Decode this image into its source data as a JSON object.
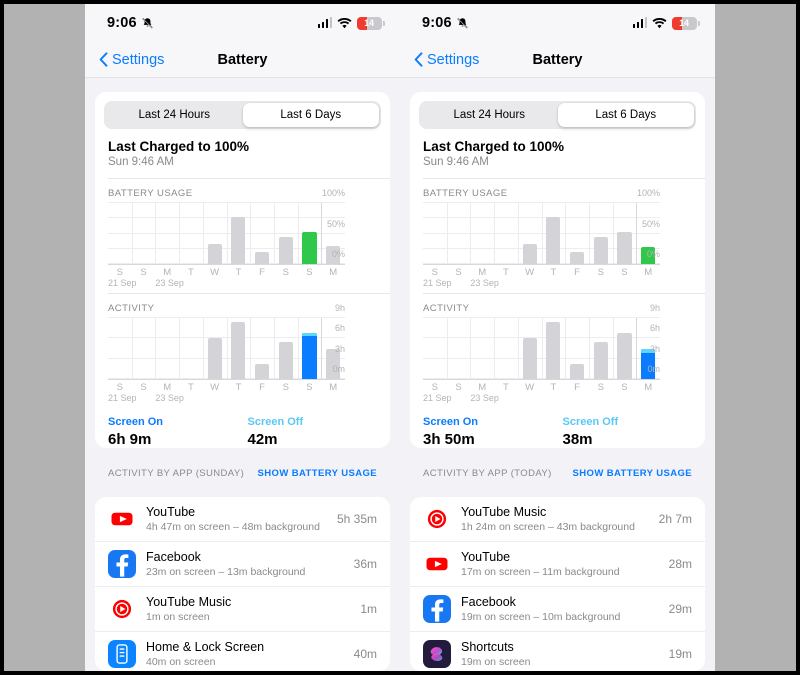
{
  "meta": {
    "page_title": "iOS Battery Settings — two screenshots",
    "outer_background": "#b2b2b2",
    "ios_background": "#f2f2f7",
    "accent_blue": "#0a7cff",
    "green": "#30c84b",
    "light_blue": "#5ad6ff",
    "gray_bar": "#d4d4d8"
  },
  "panels": [
    {
      "id": "left",
      "statusbar": {
        "time": "9:06",
        "mute_icon": "bell-slash-icon",
        "cellular_icon": "cellular-bars-icon",
        "wifi_icon": "wifi-icon",
        "battery_percent": "14",
        "battery_color": "#f03b30"
      },
      "navbar": {
        "back_label": "Settings",
        "back_icon": "chevron-left-icon",
        "title": "Battery"
      },
      "segmented": {
        "options": [
          "Last 24 Hours",
          "Last 6 Days"
        ],
        "selected": "Last 6 Days"
      },
      "last_charged": {
        "title": "Last Charged to 100%",
        "subtitle": "Sun 9:46 AM"
      },
      "battery_chart": {
        "label": "BATTERY USAGE",
        "chart_data": {
          "type": "bar",
          "title": "BATTERY USAGE",
          "categories": [
            "S",
            "S",
            "M",
            "T",
            "W",
            "T",
            "F",
            "S",
            "S",
            "M"
          ],
          "values": [
            0,
            0,
            0,
            0,
            33,
            77,
            19,
            45,
            53,
            30
          ],
          "highlight_index": 8,
          "highlight_color": "#30c84b",
          "ylabel": "",
          "xlabel": "",
          "ylim": [
            0,
            100
          ],
          "yticks": [
            "0%",
            "50%",
            "100%"
          ],
          "ytick_values": [
            0,
            50,
            100
          ],
          "gridlines": [
            0,
            25,
            50,
            75,
            100
          ],
          "date_labels": [
            {
              "text": "21 Sep",
              "column": 0
            },
            {
              "text": "23 Sep",
              "column": 2
            }
          ]
        }
      },
      "activity_chart": {
        "label": "ACTIVITY",
        "chart_data": {
          "type": "bar",
          "title": "ACTIVITY",
          "categories": [
            "S",
            "S",
            "M",
            "T",
            "W",
            "T",
            "F",
            "S",
            "S",
            "M"
          ],
          "values": [
            0,
            0,
            0,
            0,
            6.1,
            8.4,
            2.2,
            5.5,
            6.85,
            4.5
          ],
          "screen_off_caps": [
            0,
            0,
            0,
            0,
            0,
            0,
            0,
            0,
            0.55,
            0
          ],
          "highlight_index": 8,
          "highlight_color": "#0a7cff",
          "cap_color": "#5ad6ff",
          "ylabel": "",
          "xlabel": "",
          "ylim": [
            0,
            9
          ],
          "yticks": [
            "0m",
            "3h",
            "6h",
            "9h"
          ],
          "ytick_values": [
            0,
            3,
            6,
            9
          ],
          "gridlines": [
            0,
            3,
            6,
            9
          ],
          "date_labels": [
            {
              "text": "21 Sep",
              "column": 0
            },
            {
              "text": "23 Sep",
              "column": 2
            }
          ]
        }
      },
      "screen_time": {
        "on_label": "Screen On",
        "on_value": "6h 9m",
        "off_label": "Screen Off",
        "off_value": "42m"
      },
      "apps_header": {
        "title": "ACTIVITY BY APP (SUNDAY)",
        "link": "SHOW BATTERY USAGE"
      },
      "apps": [
        {
          "name": "YouTube",
          "subtitle": "4h 47m on screen – 48m background",
          "time": "5h 35m",
          "icon": "youtube-icon"
        },
        {
          "name": "Facebook",
          "subtitle": "23m on screen – 13m background",
          "time": "36m",
          "icon": "facebook-icon"
        },
        {
          "name": "YouTube Music",
          "subtitle": "1m on screen",
          "time": "1m",
          "icon": "youtube-music-icon"
        },
        {
          "name": "Home & Lock Screen",
          "subtitle": "40m on screen",
          "time": "40m",
          "icon": "home-lock-screen-icon"
        }
      ]
    },
    {
      "id": "right",
      "statusbar": {
        "time": "9:06",
        "mute_icon": "bell-slash-icon",
        "cellular_icon": "cellular-bars-icon",
        "wifi_icon": "wifi-icon",
        "battery_percent": "14",
        "battery_color": "#f03b30"
      },
      "navbar": {
        "back_label": "Settings",
        "back_icon": "chevron-left-icon",
        "title": "Battery"
      },
      "segmented": {
        "options": [
          "Last 24 Hours",
          "Last 6 Days"
        ],
        "selected": "Last 6 Days"
      },
      "last_charged": {
        "title": "Last Charged to 100%",
        "subtitle": "Sun 9:46 AM"
      },
      "battery_chart": {
        "label": "BATTERY USAGE",
        "chart_data": {
          "type": "bar",
          "title": "BATTERY USAGE",
          "categories": [
            "S",
            "S",
            "M",
            "T",
            "W",
            "T",
            "F",
            "S",
            "S",
            "M"
          ],
          "values": [
            0,
            0,
            0,
            0,
            33,
            77,
            19,
            45,
            53,
            28
          ],
          "highlight_index": 9,
          "highlight_color": "#30c84b",
          "ylabel": "",
          "xlabel": "",
          "ylim": [
            0,
            100
          ],
          "yticks": [
            "0%",
            "50%",
            "100%"
          ],
          "ytick_values": [
            0,
            50,
            100
          ],
          "gridlines": [
            0,
            25,
            50,
            75,
            100
          ],
          "date_labels": [
            {
              "text": "21 Sep",
              "column": 0
            },
            {
              "text": "23 Sep",
              "column": 2
            }
          ]
        }
      },
      "activity_chart": {
        "label": "ACTIVITY",
        "chart_data": {
          "type": "bar",
          "title": "ACTIVITY",
          "categories": [
            "S",
            "S",
            "M",
            "T",
            "W",
            "T",
            "F",
            "S",
            "S",
            "M"
          ],
          "values": [
            0,
            0,
            0,
            0,
            6.1,
            8.4,
            2.2,
            5.5,
            6.85,
            4.45
          ],
          "screen_off_caps": [
            0,
            0,
            0,
            0,
            0,
            0,
            0,
            0,
            0,
            0.6
          ],
          "highlight_index": 9,
          "highlight_color": "#0a7cff",
          "cap_color": "#5ad6ff",
          "ylabel": "",
          "xlabel": "",
          "ylim": [
            0,
            9
          ],
          "yticks": [
            "0m",
            "3h",
            "6h",
            "9h"
          ],
          "ytick_values": [
            0,
            3,
            6,
            9
          ],
          "gridlines": [
            0,
            3,
            6,
            9
          ],
          "date_labels": [
            {
              "text": "21 Sep",
              "column": 0
            },
            {
              "text": "23 Sep",
              "column": 2
            }
          ]
        }
      },
      "screen_time": {
        "on_label": "Screen On",
        "on_value": "3h 50m",
        "off_label": "Screen Off",
        "off_value": "38m"
      },
      "apps_header": {
        "title": "ACTIVITY BY APP (TODAY)",
        "link": "SHOW BATTERY USAGE"
      },
      "apps": [
        {
          "name": "YouTube Music",
          "subtitle": "1h 24m on screen – 43m background",
          "time": "2h 7m",
          "icon": "youtube-music-icon"
        },
        {
          "name": "YouTube",
          "subtitle": "17m on screen – 11m background",
          "time": "28m",
          "icon": "youtube-icon"
        },
        {
          "name": "Facebook",
          "subtitle": "19m on screen – 10m background",
          "time": "29m",
          "icon": "facebook-icon"
        },
        {
          "name": "Shortcuts",
          "subtitle": "19m on screen",
          "time": "19m",
          "icon": "shortcuts-icon"
        }
      ]
    }
  ]
}
